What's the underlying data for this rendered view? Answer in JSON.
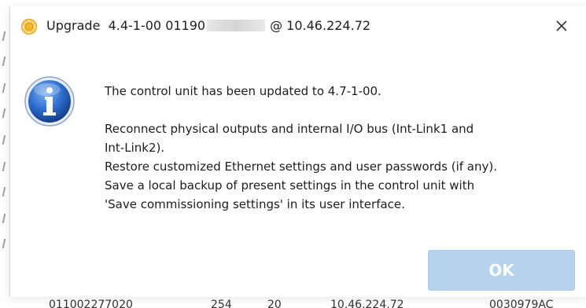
{
  "dialog": {
    "title_prefix": "Upgrade",
    "title_version": "4.4-1-00 01190",
    "title_suffix": "@ 10.46.224.72",
    "close_glyph": "✕",
    "icon": "info-icon",
    "message": {
      "line1": "The control unit has been updated to 4.7-1-00.",
      "line2": "Reconnect physical outputs and internal I/O bus (Int-Link1 and",
      "line3": "Int-Link2).",
      "line4": "Restore customized Ethernet settings and user passwords (if any).",
      "line5": "Save a local backup of present settings in the control unit with",
      "line6": "'Save commissioning settings' in its user interface."
    },
    "ok_label": "OK"
  },
  "background_row": {
    "cell1": "011002277020",
    "cell2": "254",
    "cell3": "20",
    "cell4": "10.46.224.72",
    "cell5": "0030979AC"
  },
  "colors": {
    "ok_button_bg": "#b6d2ee",
    "info_icon_blue": "#2f6fd0",
    "app_icon_gold": "#f1b52e"
  }
}
